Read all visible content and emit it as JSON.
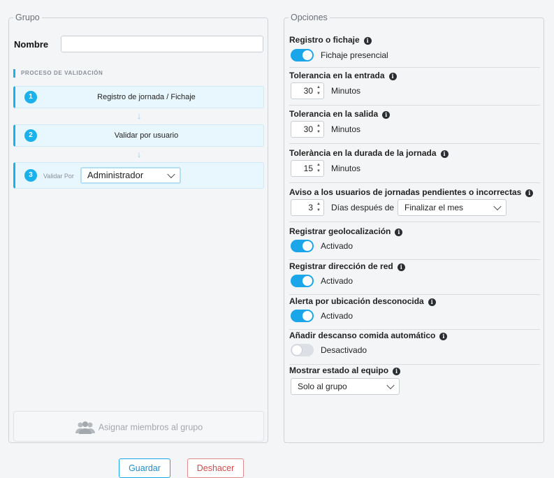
{
  "grupo": {
    "legend": "Grupo",
    "nombre_label": "Nombre",
    "nombre_value": "",
    "proceso_title": "PROCESO DE VALIDACIÓN",
    "steps": [
      {
        "num": "1",
        "label": "Registro de jornada / Fichaje"
      },
      {
        "num": "2",
        "label": "Validar por usuario"
      },
      {
        "num": "3",
        "label": "Validar Por",
        "select": "Administrador"
      }
    ],
    "assign_label": "Asignar miembros al grupo"
  },
  "opciones": {
    "legend": "Opciones",
    "registro": {
      "title": "Registro o fichaje",
      "toggle": "on",
      "value": "Fichaje presencial"
    },
    "tol_entrada": {
      "title": "Tolerancia en la entrada",
      "value": "30",
      "unit": "Minutos"
    },
    "tol_salida": {
      "title": "Tolerancia en la salida",
      "value": "30",
      "unit": "Minutos"
    },
    "tol_jornada": {
      "title": "Tolerància en la durada de la jornada",
      "value": "15",
      "unit": "Minutos"
    },
    "aviso": {
      "title": "Aviso a los usuarios de jornadas pendientes o incorrectas",
      "value": "3",
      "unit": "Días después de",
      "select": "Finalizar el mes"
    },
    "geoloc": {
      "title": "Registrar geolocalización",
      "toggle": "on",
      "value": "Activado"
    },
    "red": {
      "title": "Registrar dirección de red",
      "toggle": "on",
      "value": "Activado"
    },
    "ubicacion": {
      "title": "Alerta por ubicación desconocida",
      "toggle": "on",
      "value": "Activado"
    },
    "descanso": {
      "title": "Añadir descanso comida automático",
      "toggle": "off",
      "value": "Desactivado"
    },
    "estado": {
      "title": "Mostrar estado al equipo",
      "select": "Solo al grupo"
    }
  },
  "buttons": {
    "save": "Guardar",
    "undo": "Deshacer"
  },
  "icons": {
    "info": "info-icon",
    "members": "users-icon",
    "arrow": "arrow-down-icon",
    "chevron": "chevron-down-icon"
  },
  "colors": {
    "accent": "#1aa6e8",
    "danger": "#d04a4a"
  }
}
